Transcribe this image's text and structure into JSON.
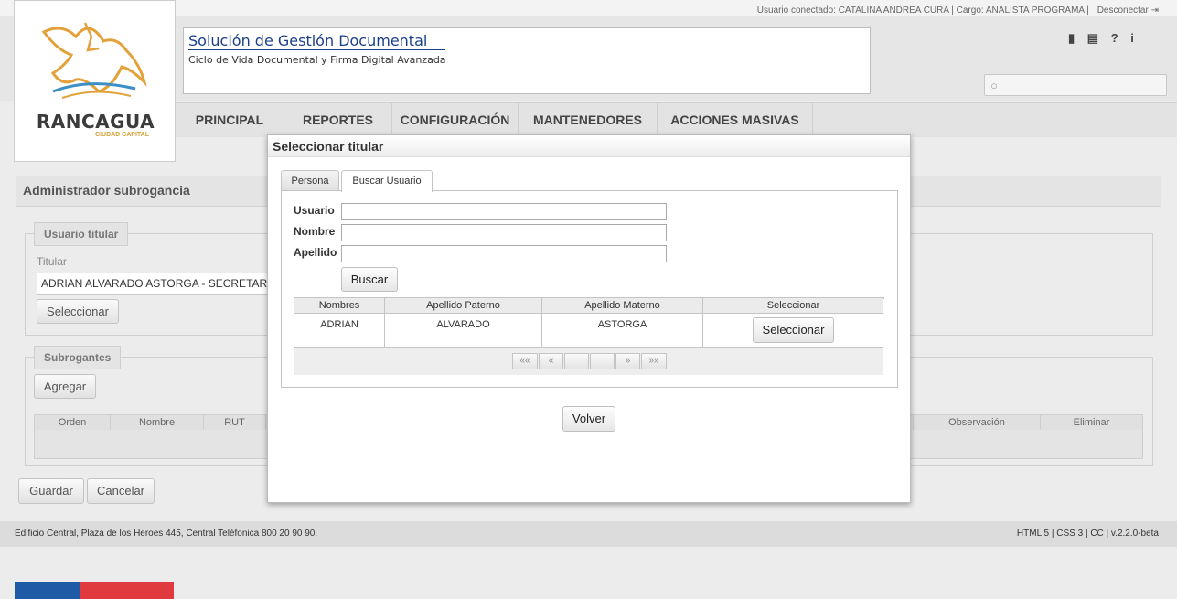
{
  "topbar": {
    "user_label": "Usuario conectado:",
    "user_name": "CATALINA ANDREA CURA",
    "role_label": "| Cargo:",
    "role": "ANALISTA PROGRAMA",
    "separator": "|",
    "logout": "Desconectar"
  },
  "logo": {
    "name": "RANCAGUA",
    "subtitle": "CIUDAD CAPITAL"
  },
  "header": {
    "title": "Solución de Gestión Documental",
    "subtitle": "Ciclo de Vida Documental y Firma Digital Avanzada"
  },
  "icons": {
    "book": "book-icon",
    "news": "newspaper-icon",
    "help": "?",
    "info": "i"
  },
  "nav": [
    "PRINCIPAL",
    "REPORTES",
    "CONFIGURACIÓN",
    "MANTENEDORES",
    "ACCIONES MASIVAS"
  ],
  "page": {
    "title": "Administrador subrogancia",
    "titular_legend": "Usuario titular",
    "titular_label": "Titular",
    "titular_value": "ADRIAN ALVARADO ASTORGA - SECRETARI",
    "select_button": "Seleccionar",
    "subrogantes_legend": "Subrogantes",
    "add_button": "Agregar",
    "columns": [
      "Orden",
      "Nombre",
      "RUT",
      "Observación",
      "Eliminar"
    ],
    "save_button": "Guardar",
    "cancel_button": "Cancelar"
  },
  "footer": {
    "address": "Edificio Central, Plaza de los Heroes 445, Central Teléfonica 800 20 90 90.",
    "right": "HTML 5 | CSS 3 | CC | v.2.2.0-beta"
  },
  "modal": {
    "title": "Seleccionar titular",
    "tabs": [
      "Persona",
      "Buscar Usuario"
    ],
    "fields": [
      "Usuario",
      "Nombre",
      "Apellido"
    ],
    "search_button": "Buscar",
    "columns": [
      "Nombres",
      "Apellido Paterno",
      "Apellido Materno",
      "Seleccionar"
    ],
    "row": {
      "nombres": "ADRIAN",
      "paterno": "ALVARADO",
      "materno": "ASTORGA",
      "action": "Seleccionar"
    },
    "pager": [
      "««",
      "«",
      "",
      "",
      "»",
      "»»"
    ],
    "back_button": "Volver"
  }
}
